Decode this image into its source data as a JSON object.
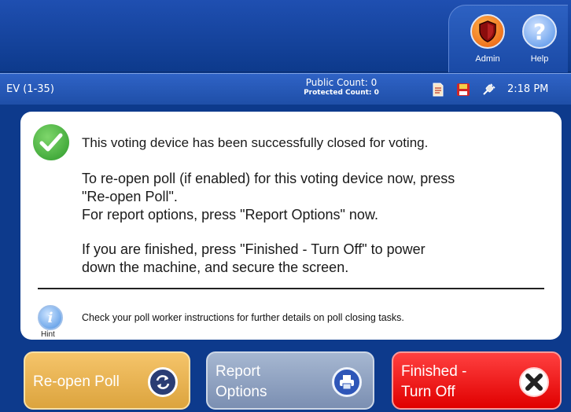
{
  "header": {
    "admin_label": "Admin",
    "help_label": "Help",
    "help_glyph": "?",
    "icons": {
      "admin": "shield-icon",
      "help": "question-icon"
    }
  },
  "status": {
    "device_label": "EV (1-35)",
    "public_count": "Public Count: 0",
    "protected_count": "Protected Count: 0",
    "time": "2:18 PM",
    "icons": [
      "document-icon",
      "floppy-disk-icon",
      "power-plug-icon"
    ]
  },
  "message": {
    "closed": "This voting device has been successfully closed for voting.",
    "reopen_line1": "To re-open poll (if enabled) for this voting device now, press",
    "reopen_line2": "\"Re-open Poll\".",
    "report_line": "For report options, press \"Report Options\" now.",
    "finished_line1": "If you are finished, press \"Finished - Turn Off\" to power",
    "finished_line2": "down the machine, and secure the screen."
  },
  "hint": {
    "glyph": "i",
    "label": "Hint",
    "text": "Check your poll worker instructions for further details on poll closing tasks."
  },
  "buttons": {
    "reopen": "Re-open Poll",
    "report_line1": "Report",
    "report_line2": "Options",
    "finish_line1": "Finished -",
    "finish_line2": "Turn Off"
  },
  "colors": {
    "background": "#0d3a8c",
    "reopen": "#dca43e",
    "report": "#7b8fb2",
    "finish": "#e00000",
    "success": "#2d9a2a"
  }
}
